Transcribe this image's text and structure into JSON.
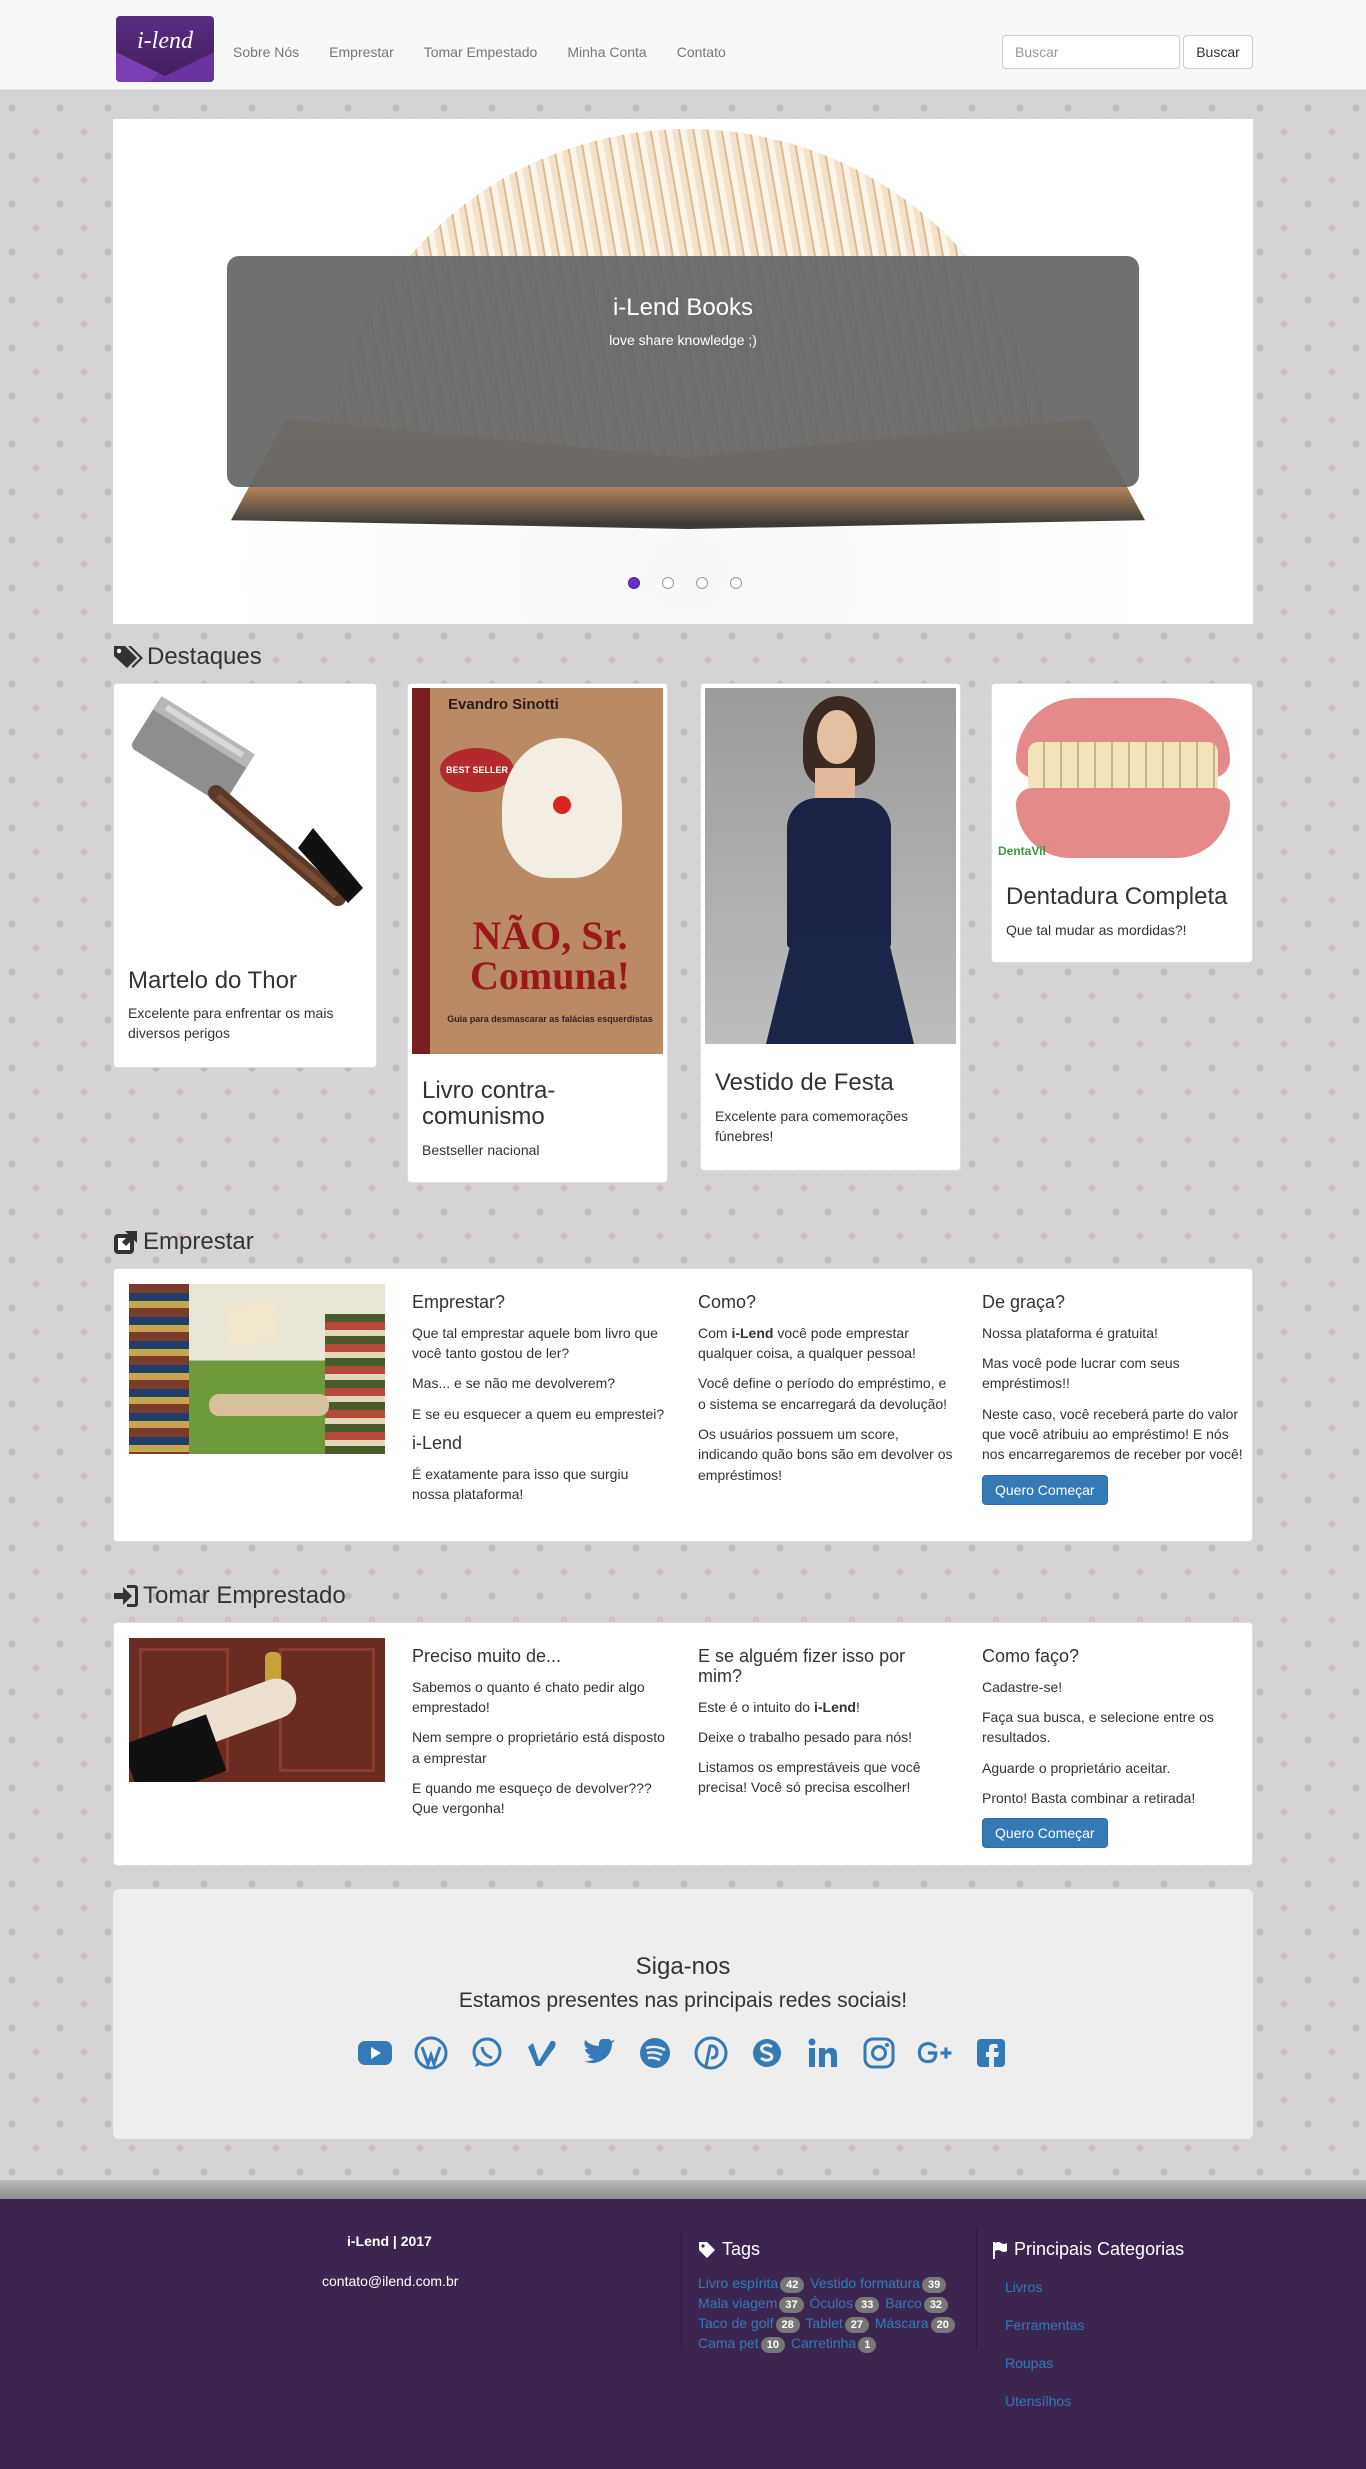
{
  "nav": {
    "logo_text": "i-lend",
    "links": [
      "Sobre Nós",
      "Emprestar",
      "Tomar Empestado",
      "Minha Conta",
      "Contato"
    ],
    "search_placeholder": "Buscar",
    "search_button": "Buscar"
  },
  "carousel": {
    "title": "i-Lend Books",
    "subtitle": "love share knowledge ;)",
    "slide_count": 4,
    "active_slide": 1
  },
  "destaques": {
    "title": "Destaques",
    "cards": [
      {
        "title": "Martelo do Thor",
        "text": "Excelente para enfrentar os mais diversos perigos"
      },
      {
        "title": "Livro contra-comunismo",
        "text": "Bestseller nacional",
        "cover_author": "Evandro Sinotti",
        "cover_badge": "BEST SELLER",
        "cover_title": "NÃO, Sr. Comuna!",
        "cover_sub": "Guia para desmascarar as falácias esquerdistas"
      },
      {
        "title": "Vestido de Festa",
        "text": "Excelente para comemorações fúnebres!"
      },
      {
        "title": "Dentadura Completa",
        "text": "Que tal mudar as mordidas?!",
        "image_logo": "DentaVil"
      }
    ]
  },
  "emprestar": {
    "title": "Emprestar",
    "col1": {
      "heading": "Emprestar?",
      "p1": "Que tal emprestar aquele bom livro que você tanto gostou de ler?",
      "p2": "Mas... e se não me devolverem?",
      "p3": "E se eu esquecer a quem eu emprestei?",
      "heading2": "i-Lend",
      "p4": "É exatamente para isso que surgiu nossa plataforma!"
    },
    "col2": {
      "heading": "Como?",
      "p1_pre": "Com ",
      "p1_bold": "i-Lend",
      "p1_post": " você pode emprestar qualquer coisa, a qualquer pessoa!",
      "p2": "Você define o período do empréstimo, e o sistema se encarregará da devolução!",
      "p3": "Os usuários possuem um score, indicando quão bons são em devolver os empréstimos!"
    },
    "col3": {
      "heading": "De graça?",
      "p1": "Nossa plataforma é gratuita!",
      "p2": "Mas você pode lucrar com seus empréstimos!!",
      "p3": "Neste caso, você receberá parte do valor que você atribuiu ao empréstimo! E nós nos encarregaremos de receber por você!",
      "button": "Quero Começar"
    }
  },
  "tomar": {
    "title": "Tomar Emprestado",
    "col1": {
      "heading": "Preciso muito de...",
      "p1": "Sabemos o quanto é chato pedir algo emprestado!",
      "p2": "Nem sempre o proprietário está disposto a emprestar",
      "p3": "E quando me esqueço de devolver??? Que vergonha!"
    },
    "col2": {
      "heading": "E se alguém fizer isso por mim?",
      "p1_pre": "Este é o intuito do ",
      "p1_bold": "i-Lend",
      "p1_post": "!",
      "p2": "Deixe o trabalho pesado para nós!",
      "p3": "Listamos os emprestáveis que você precisa! Você só precisa escolher!"
    },
    "col3": {
      "heading": "Como faço?",
      "p1": "Cadastre-se!",
      "p2": "Faça sua busca, e selecione entre os resultados.",
      "p3": "Aguarde o proprietário aceitar.",
      "p4": "Pronto! Basta combinar a retirada!",
      "button": "Quero Começar"
    }
  },
  "social": {
    "title": "Siga-nos",
    "subtitle": "Estamos presentes nas principais redes sociais!",
    "icons": [
      "youtube-icon",
      "wordpress-icon",
      "whatsapp-icon",
      "vimeo-icon",
      "twitter-icon",
      "spotify-icon",
      "pinterest-icon",
      "skype-icon",
      "linkedin-icon",
      "instagram-icon",
      "google-plus-icon",
      "facebook-icon"
    ]
  },
  "footer": {
    "brand": "i-Lend | 2017",
    "email": "contato@ilend.com.br",
    "tags_title": "Tags",
    "tags": [
      {
        "name": "Livro espírita",
        "count": "42"
      },
      {
        "name": "Vestido formatura",
        "count": "39"
      },
      {
        "name": "Mala viagem",
        "count": "37"
      },
      {
        "name": "Óculos",
        "count": "33"
      },
      {
        "name": "Barco",
        "count": "32"
      },
      {
        "name": "Taco de golf",
        "count": "28"
      },
      {
        "name": "Tablet",
        "count": "27"
      },
      {
        "name": "Máscara",
        "count": "20"
      },
      {
        "name": "Cama pet",
        "count": "10"
      },
      {
        "name": "Carretinha",
        "count": "1"
      }
    ],
    "categories_title": "Principais Categorias",
    "categories": [
      "Livros",
      "Ferramentas",
      "Roupas",
      "Utensílhos"
    ]
  },
  "colors": {
    "primary": "#337ab7",
    "footer_bg": "#3c2650",
    "active_dot": "#6a2fc6"
  }
}
